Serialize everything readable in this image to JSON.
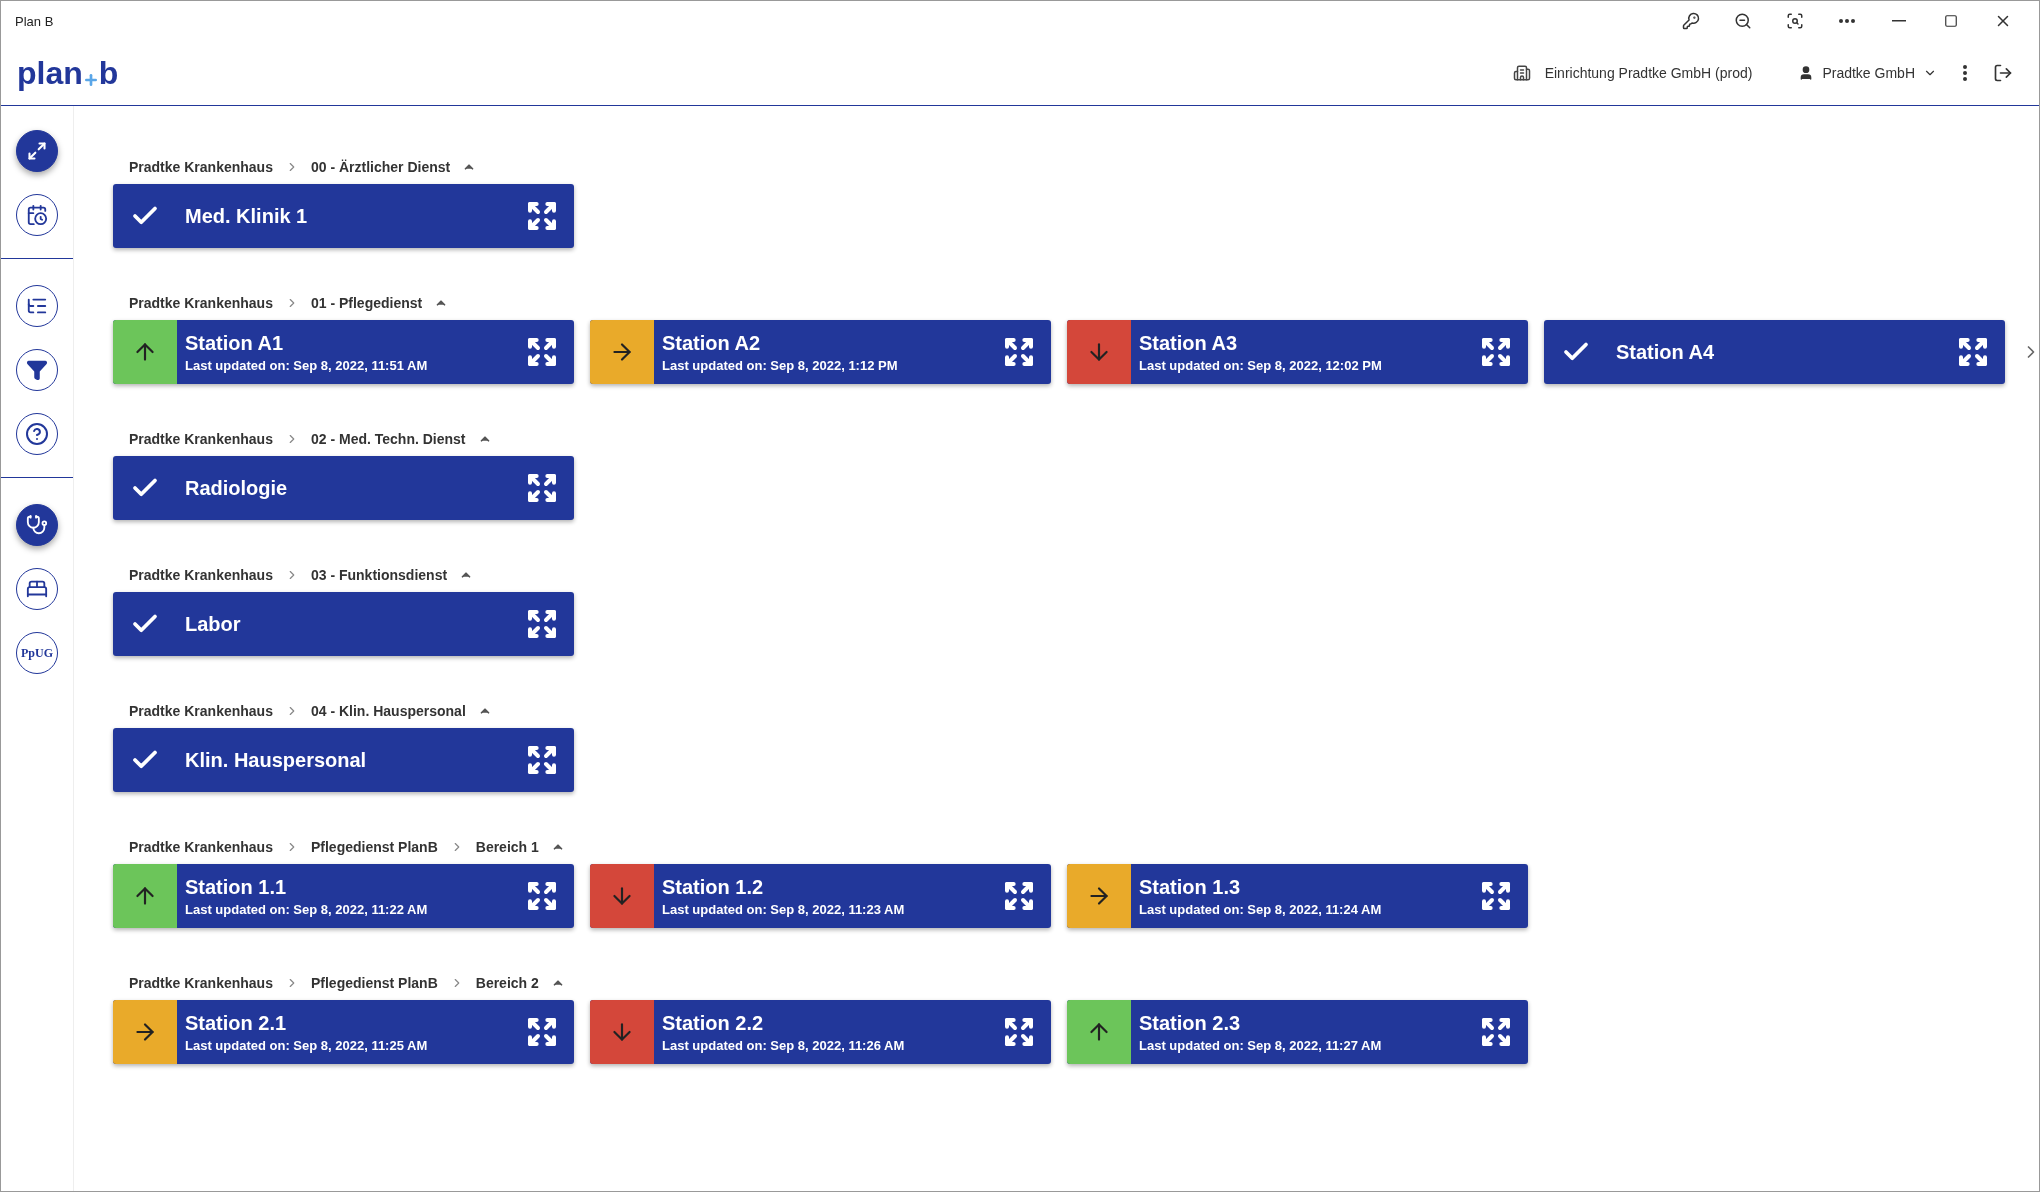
{
  "window": {
    "title": "Plan B"
  },
  "header": {
    "logo": {
      "left": "plan",
      "right": "b"
    },
    "facility": "Einrichtung Pradtke GmbH (prod)",
    "user": "Pradtke GmbH"
  },
  "sidebar": {
    "groups": [
      [
        {
          "selected": true
        },
        {
          "selected": false
        }
      ],
      [
        {
          "selected": false
        },
        {
          "selected": false
        },
        {
          "selected": false
        }
      ],
      [
        {
          "selected": true
        },
        {
          "selected": false
        },
        {
          "label": "PpUG",
          "selected": false
        }
      ]
    ]
  },
  "groups": [
    {
      "breadcrumb": [
        "Pradtke Krankenhaus",
        "00 - Ärztlicher Dienst"
      ],
      "more": false,
      "cards": [
        {
          "kind": "done",
          "title": "Med. Klinik 1"
        }
      ]
    },
    {
      "breadcrumb": [
        "Pradtke Krankenhaus",
        "01 - Pflegedienst"
      ],
      "more": true,
      "cards": [
        {
          "kind": "rising",
          "color": "#6cc55a",
          "title": "Station A1",
          "updated": "Last updated on: Sep 8, 2022, 11:51 AM"
        },
        {
          "kind": "steady",
          "color": "#e9aa2a",
          "title": "Station A2",
          "updated": "Last updated on: Sep 8, 2022, 1:12 PM"
        },
        {
          "kind": "falling",
          "color": "#d4473a",
          "title": "Station A3",
          "updated": "Last updated on: Sep 8, 2022, 12:02 PM"
        },
        {
          "kind": "done",
          "title": "Station A4"
        }
      ]
    },
    {
      "breadcrumb": [
        "Pradtke Krankenhaus",
        "02 - Med. Techn. Dienst"
      ],
      "more": false,
      "cards": [
        {
          "kind": "done",
          "title": "Radiologie"
        }
      ]
    },
    {
      "breadcrumb": [
        "Pradtke Krankenhaus",
        "03 - Funktionsdienst"
      ],
      "more": false,
      "cards": [
        {
          "kind": "done",
          "title": "Labor"
        }
      ]
    },
    {
      "breadcrumb": [
        "Pradtke Krankenhaus",
        "04 - Klin. Hauspersonal"
      ],
      "more": false,
      "cards": [
        {
          "kind": "done",
          "title": "Klin. Hauspersonal"
        }
      ]
    },
    {
      "breadcrumb": [
        "Pradtke Krankenhaus",
        "Pflegedienst PlanB",
        "Bereich 1"
      ],
      "more": false,
      "cards": [
        {
          "kind": "rising",
          "color": "#6cc55a",
          "title": "Station 1.1",
          "updated": "Last updated on: Sep 8, 2022, 11:22 AM"
        },
        {
          "kind": "falling",
          "color": "#d4473a",
          "title": "Station 1.2",
          "updated": "Last updated on: Sep 8, 2022, 11:23 AM"
        },
        {
          "kind": "steady",
          "color": "#e9aa2a",
          "title": "Station 1.3",
          "updated": "Last updated on: Sep 8, 2022, 11:24 AM"
        }
      ]
    },
    {
      "breadcrumb": [
        "Pradtke Krankenhaus",
        "Pflegedienst PlanB",
        "Bereich 2"
      ],
      "more": false,
      "cards": [
        {
          "kind": "steady",
          "color": "#e9aa2a",
          "title": "Station 2.1",
          "updated": "Last updated on: Sep 8, 2022, 11:25 AM"
        },
        {
          "kind": "falling",
          "color": "#d4473a",
          "title": "Station 2.2",
          "updated": "Last updated on: Sep 8, 2022, 11:26 AM"
        },
        {
          "kind": "rising",
          "color": "#6cc55a",
          "title": "Station 2.3",
          "updated": "Last updated on: Sep 8, 2022, 11:27 AM"
        }
      ]
    }
  ]
}
